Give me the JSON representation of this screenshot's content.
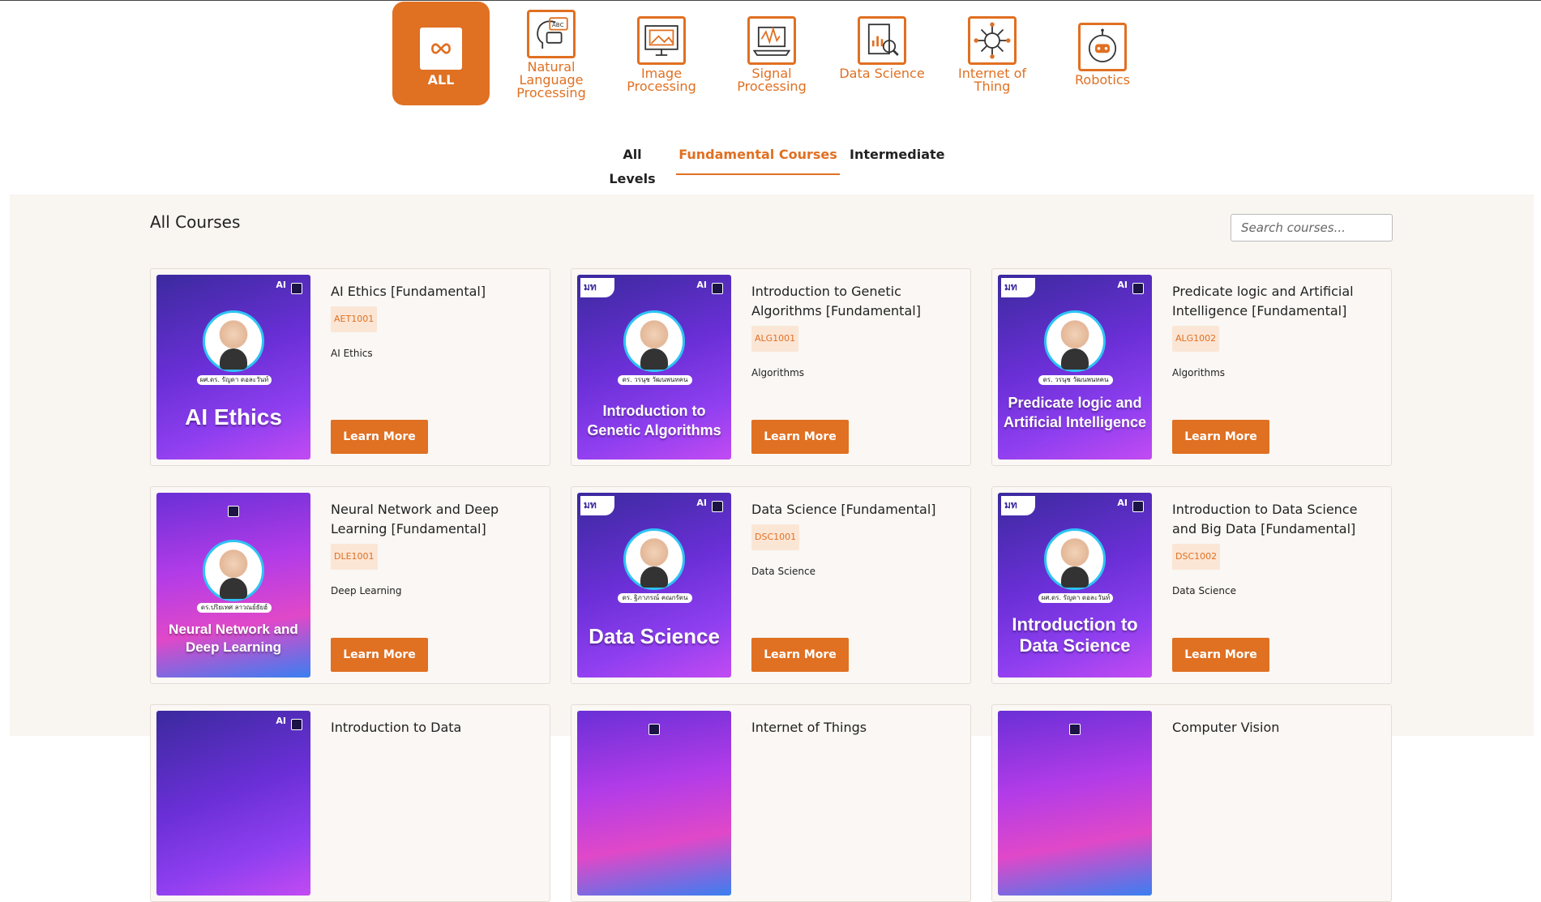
{
  "categories": [
    {
      "label": "ALL",
      "icon": "infinity-icon",
      "active": true
    },
    {
      "label": "Natural Language Processing",
      "icon": "head-chat-icon"
    },
    {
      "label": "Image Processing",
      "icon": "image-monitor-icon"
    },
    {
      "label": "Signal Processing",
      "icon": "signal-laptop-icon"
    },
    {
      "label": "Data Science",
      "icon": "data-report-icon"
    },
    {
      "label": "Internet of Thing",
      "icon": "network-brain-icon"
    },
    {
      "label": "Robotics",
      "icon": "robot-icon"
    }
  ],
  "levels": [
    {
      "label": "All Levels"
    },
    {
      "label": "Fundamental Courses",
      "active": true
    },
    {
      "label": "Intermediate"
    }
  ],
  "panel": {
    "title": "All Courses",
    "search_placeholder": "Search courses..."
  },
  "courses": [
    {
      "title": "AI Ethics [Fundamental]",
      "code": "AET1001",
      "category": "AI Ethics",
      "thumb_title": "AI Ethics",
      "thumb_name": "ผศ.ดร. รัญดา ดอละวันท์",
      "button": "Learn More"
    },
    {
      "title": "Introduction to Genetic Algorithms [Fundamental]",
      "code": "ALG1001",
      "category": "Algorithms",
      "thumb_title": "Introduction to Genetic Algorithms",
      "thumb_name": "ดร. วรนุช วัฒนพนทคน",
      "button": "Learn More"
    },
    {
      "title": "Predicate logic and Artificial Intelligence [Fundamental]",
      "code": "ALG1002",
      "category": "Algorithms",
      "thumb_title": "Predicate logic and Artificial Intelligence",
      "thumb_name": "ดร. วรนุช วัฒนพนทคน",
      "button": "Learn More"
    },
    {
      "title": "Neural Network and Deep Learning [Fundamental]",
      "code": "DLE1001",
      "category": "Deep Learning",
      "thumb_title": "Neural Network and Deep Learning",
      "thumb_name": "ดร.ปริยเทศ ลาวณย์ธัยฮ์",
      "button": "Learn More"
    },
    {
      "title": "Data Science [Fundamental]",
      "code": "DSC1001",
      "category": "Data Science",
      "thumb_title": "Data Science",
      "thumb_name": "ดร. ฐิภาภรณ์ คณกรัตน",
      "button": "Learn More"
    },
    {
      "title": "Introduction to Data Science and Big Data [Fundamental]",
      "code": "DSC1002",
      "category": "Data Science",
      "thumb_title": "Introduction to Data Science",
      "thumb_name": "ผศ.ดร. รัญดา ดอละวันท์",
      "button": "Learn More"
    },
    {
      "title": "Introduction to Data",
      "partial": true
    },
    {
      "title": "Internet of Things",
      "partial": true
    },
    {
      "title": "Computer Vision",
      "partial": true
    }
  ],
  "thumb_brand": "AI",
  "thumb_logo": "มท"
}
